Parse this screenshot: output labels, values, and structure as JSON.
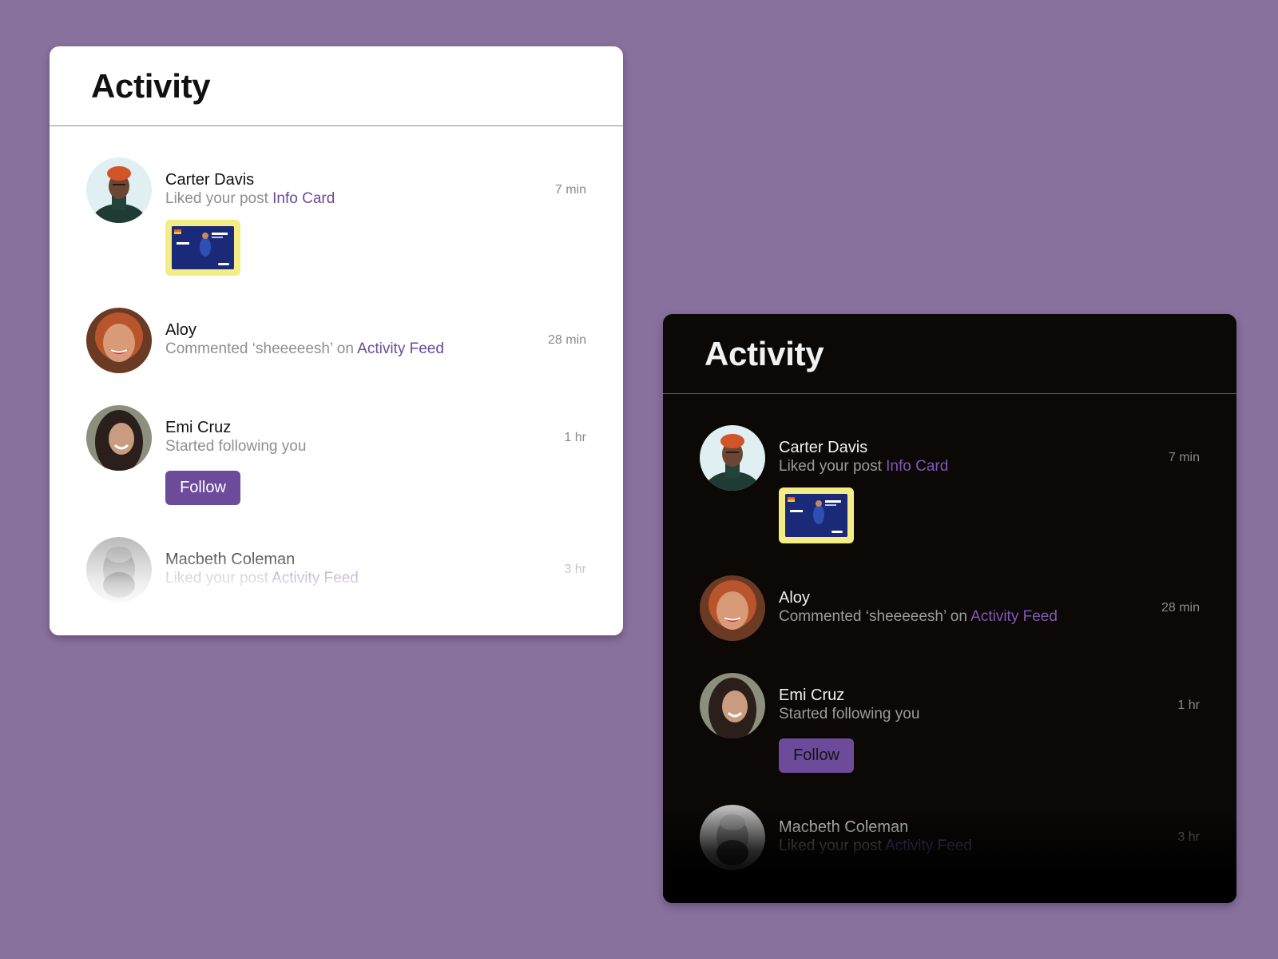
{
  "colors": {
    "background": "#89719d",
    "accent": "#6c4b9a",
    "link": "#6a4a9a",
    "thumbnail_frame": "#f4ec85"
  },
  "light_card": {
    "title": "Activity",
    "items": [
      {
        "name": "Carter Davis",
        "verb": "Liked",
        "middle": " your post ",
        "target": "Info Card",
        "time": "7 min"
      },
      {
        "name": "Aloy",
        "verb": "Commented",
        "middle": " ‘sheeeeesh’ on ",
        "target": "Activity Feed",
        "time": "28 min"
      },
      {
        "name": "Emi Cruz",
        "verb": "Started",
        "middle": " following you",
        "target": "",
        "time": "1 hr",
        "button": "Follow"
      },
      {
        "name": "Macbeth Coleman",
        "verb": "Liked",
        "middle": " your post ",
        "target": "Activity Feed",
        "time": "3 hr"
      }
    ]
  },
  "dark_card": {
    "title": "Activity",
    "items": [
      {
        "name": "Carter Davis",
        "verb": "Liked",
        "middle": " your post ",
        "target": "Info Card",
        "time": "7 min"
      },
      {
        "name": "Aloy",
        "verb": "Commented",
        "middle": " ‘sheeeeesh’ on ",
        "target": "Activity Feed",
        "time": "28 min"
      },
      {
        "name": "Emi Cruz",
        "verb": "Started",
        "middle": " following you",
        "target": "",
        "time": "1 hr",
        "button": "Follow"
      },
      {
        "name": "Macbeth Coleman",
        "verb": "Liked",
        "middle": " your post ",
        "target": "Activity Feed",
        "time": "3 hr"
      }
    ]
  }
}
